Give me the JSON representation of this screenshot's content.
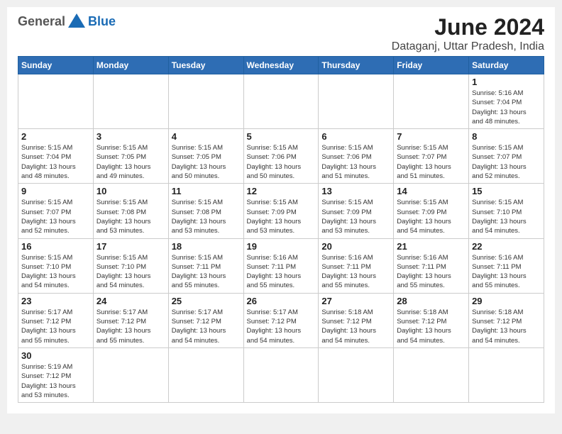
{
  "header": {
    "logo_general": "General",
    "logo_blue": "Blue",
    "month": "June 2024",
    "location": "Dataganj, Uttar Pradesh, India"
  },
  "weekdays": [
    "Sunday",
    "Monday",
    "Tuesday",
    "Wednesday",
    "Thursday",
    "Friday",
    "Saturday"
  ],
  "weeks": [
    [
      {
        "day": "",
        "info": ""
      },
      {
        "day": "",
        "info": ""
      },
      {
        "day": "",
        "info": ""
      },
      {
        "day": "",
        "info": ""
      },
      {
        "day": "",
        "info": ""
      },
      {
        "day": "",
        "info": ""
      },
      {
        "day": "1",
        "info": "Sunrise: 5:16 AM\nSunset: 7:04 PM\nDaylight: 13 hours\nand 48 minutes."
      }
    ],
    [
      {
        "day": "2",
        "info": "Sunrise: 5:15 AM\nSunset: 7:04 PM\nDaylight: 13 hours\nand 48 minutes."
      },
      {
        "day": "3",
        "info": "Sunrise: 5:15 AM\nSunset: 7:05 PM\nDaylight: 13 hours\nand 49 minutes."
      },
      {
        "day": "4",
        "info": "Sunrise: 5:15 AM\nSunset: 7:05 PM\nDaylight: 13 hours\nand 50 minutes."
      },
      {
        "day": "5",
        "info": "Sunrise: 5:15 AM\nSunset: 7:06 PM\nDaylight: 13 hours\nand 50 minutes."
      },
      {
        "day": "6",
        "info": "Sunrise: 5:15 AM\nSunset: 7:06 PM\nDaylight: 13 hours\nand 51 minutes."
      },
      {
        "day": "7",
        "info": "Sunrise: 5:15 AM\nSunset: 7:07 PM\nDaylight: 13 hours\nand 51 minutes."
      },
      {
        "day": "8",
        "info": "Sunrise: 5:15 AM\nSunset: 7:07 PM\nDaylight: 13 hours\nand 52 minutes."
      }
    ],
    [
      {
        "day": "9",
        "info": "Sunrise: 5:15 AM\nSunset: 7:07 PM\nDaylight: 13 hours\nand 52 minutes."
      },
      {
        "day": "10",
        "info": "Sunrise: 5:15 AM\nSunset: 7:08 PM\nDaylight: 13 hours\nand 53 minutes."
      },
      {
        "day": "11",
        "info": "Sunrise: 5:15 AM\nSunset: 7:08 PM\nDaylight: 13 hours\nand 53 minutes."
      },
      {
        "day": "12",
        "info": "Sunrise: 5:15 AM\nSunset: 7:09 PM\nDaylight: 13 hours\nand 53 minutes."
      },
      {
        "day": "13",
        "info": "Sunrise: 5:15 AM\nSunset: 7:09 PM\nDaylight: 13 hours\nand 53 minutes."
      },
      {
        "day": "14",
        "info": "Sunrise: 5:15 AM\nSunset: 7:09 PM\nDaylight: 13 hours\nand 54 minutes."
      },
      {
        "day": "15",
        "info": "Sunrise: 5:15 AM\nSunset: 7:10 PM\nDaylight: 13 hours\nand 54 minutes."
      }
    ],
    [
      {
        "day": "16",
        "info": "Sunrise: 5:15 AM\nSunset: 7:10 PM\nDaylight: 13 hours\nand 54 minutes."
      },
      {
        "day": "17",
        "info": "Sunrise: 5:15 AM\nSunset: 7:10 PM\nDaylight: 13 hours\nand 54 minutes."
      },
      {
        "day": "18",
        "info": "Sunrise: 5:15 AM\nSunset: 7:11 PM\nDaylight: 13 hours\nand 55 minutes."
      },
      {
        "day": "19",
        "info": "Sunrise: 5:16 AM\nSunset: 7:11 PM\nDaylight: 13 hours\nand 55 minutes."
      },
      {
        "day": "20",
        "info": "Sunrise: 5:16 AM\nSunset: 7:11 PM\nDaylight: 13 hours\nand 55 minutes."
      },
      {
        "day": "21",
        "info": "Sunrise: 5:16 AM\nSunset: 7:11 PM\nDaylight: 13 hours\nand 55 minutes."
      },
      {
        "day": "22",
        "info": "Sunrise: 5:16 AM\nSunset: 7:11 PM\nDaylight: 13 hours\nand 55 minutes."
      }
    ],
    [
      {
        "day": "23",
        "info": "Sunrise: 5:17 AM\nSunset: 7:12 PM\nDaylight: 13 hours\nand 55 minutes."
      },
      {
        "day": "24",
        "info": "Sunrise: 5:17 AM\nSunset: 7:12 PM\nDaylight: 13 hours\nand 55 minutes."
      },
      {
        "day": "25",
        "info": "Sunrise: 5:17 AM\nSunset: 7:12 PM\nDaylight: 13 hours\nand 54 minutes."
      },
      {
        "day": "26",
        "info": "Sunrise: 5:17 AM\nSunset: 7:12 PM\nDaylight: 13 hours\nand 54 minutes."
      },
      {
        "day": "27",
        "info": "Sunrise: 5:18 AM\nSunset: 7:12 PM\nDaylight: 13 hours\nand 54 minutes."
      },
      {
        "day": "28",
        "info": "Sunrise: 5:18 AM\nSunset: 7:12 PM\nDaylight: 13 hours\nand 54 minutes."
      },
      {
        "day": "29",
        "info": "Sunrise: 5:18 AM\nSunset: 7:12 PM\nDaylight: 13 hours\nand 54 minutes."
      }
    ],
    [
      {
        "day": "30",
        "info": "Sunrise: 5:19 AM\nSunset: 7:12 PM\nDaylight: 13 hours\nand 53 minutes."
      },
      {
        "day": "",
        "info": ""
      },
      {
        "day": "",
        "info": ""
      },
      {
        "day": "",
        "info": ""
      },
      {
        "day": "",
        "info": ""
      },
      {
        "day": "",
        "info": ""
      },
      {
        "day": "",
        "info": ""
      }
    ]
  ]
}
